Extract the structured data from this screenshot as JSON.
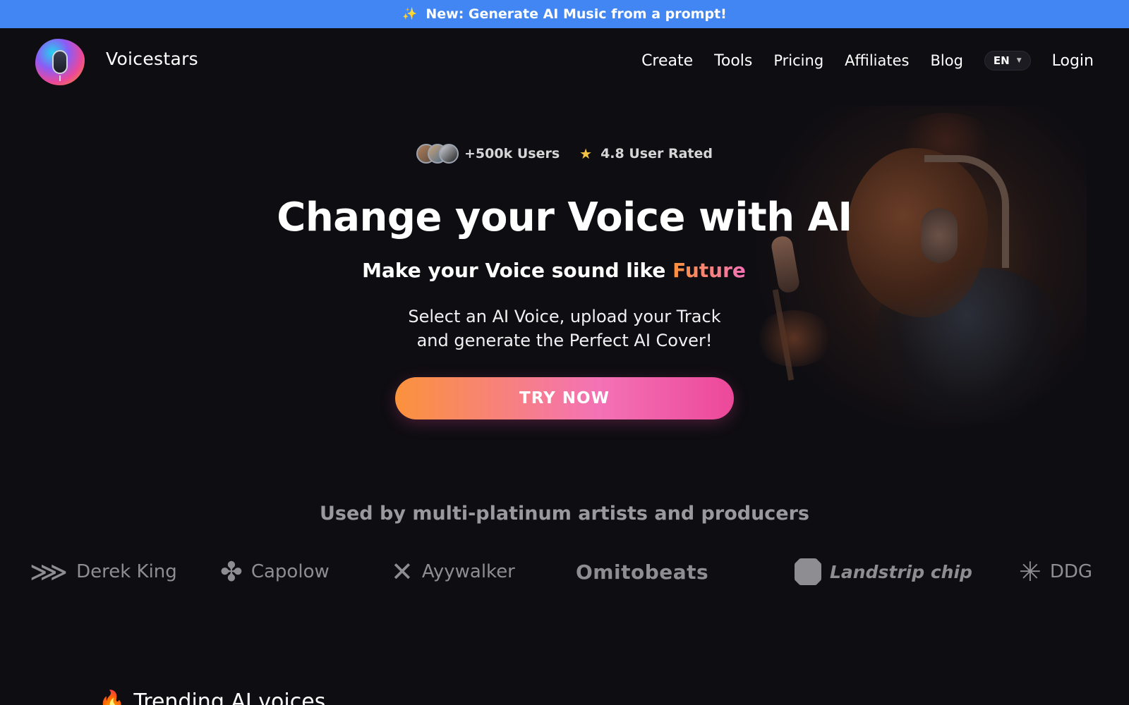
{
  "announcement": {
    "icon": "sparkles-icon",
    "glyph": "✨",
    "text": "New: Generate AI Music from a prompt!"
  },
  "nav": {
    "brand": "Voicestars",
    "links": [
      "Create",
      "Tools",
      "Pricing",
      "Affiliates",
      "Blog"
    ],
    "language": "EN",
    "login": "Login"
  },
  "hero": {
    "users": "+500k Users",
    "rating": "4.8 User Rated",
    "title": "Change your Voice with AI",
    "subtitle_prefix": "Make your Voice sound like ",
    "subtitle_accent": "Future",
    "desc_line1": "Select an AI Voice, upload your Track",
    "desc_line2": "and generate the Perfect AI Cover!",
    "cta": "TRY NOW"
  },
  "social_proof": {
    "heading": "Used by multi-platinum artists and producers",
    "brands": [
      {
        "name": "Derek King",
        "icon": "double-chevron-icon",
        "glyph": "⋙"
      },
      {
        "name": "Capolow",
        "icon": "four-circles-icon",
        "glyph": "✤"
      },
      {
        "name": "Ayywalker",
        "icon": "x-shape-icon",
        "glyph": "✕"
      },
      {
        "name": "Omitobeats",
        "icon": "",
        "glyph": ""
      },
      {
        "name": "Landstrip chip",
        "icon": "rounded-square-icon",
        "glyph": ""
      },
      {
        "name": "DDG",
        "icon": "asterisk-icon",
        "glyph": "✳"
      }
    ]
  },
  "trending": {
    "icon": "fire-icon",
    "glyph": "🔥",
    "title": "Trending AI voices"
  },
  "colors": {
    "announcement_bg": "#4286f4",
    "page_bg": "#0e0d12",
    "cta_gradient_start": "#fb923c",
    "cta_gradient_end": "#ec4899"
  }
}
